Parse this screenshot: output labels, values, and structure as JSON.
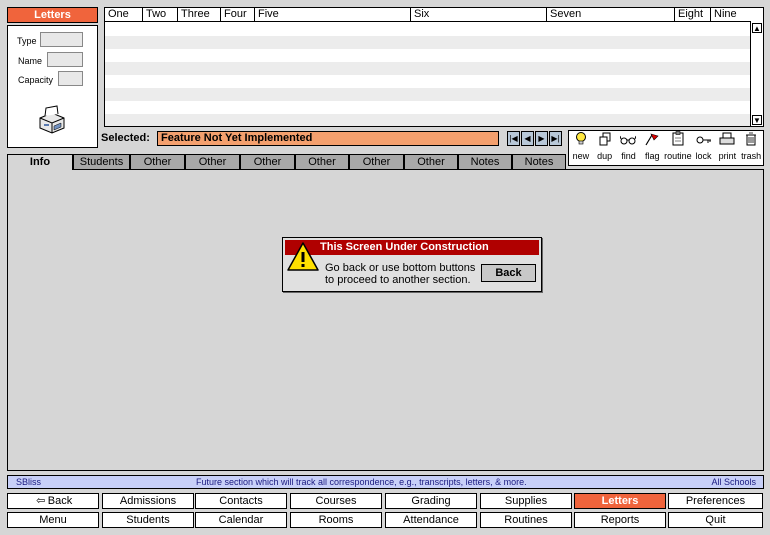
{
  "panel": {
    "title": "Letters",
    "fields": [
      {
        "label": "Type",
        "value": ""
      },
      {
        "label": "Name",
        "value": ""
      },
      {
        "label": "Capacity",
        "value": ""
      }
    ],
    "printer_icon": "printer-icon"
  },
  "grid": {
    "columns": [
      "One",
      "Two",
      "Three",
      "Four",
      "Five",
      "Six",
      "Seven",
      "Eight",
      "Nine"
    ],
    "rows": []
  },
  "selected": {
    "label": "Selected:",
    "value": "Feature Not Yet Implemented"
  },
  "record_nav": [
    "first",
    "prev",
    "next",
    "last"
  ],
  "toolbar": [
    {
      "label": "new",
      "icon": "lightbulb-icon"
    },
    {
      "label": "dup",
      "icon": "duplicate-icon"
    },
    {
      "label": "find",
      "icon": "glasses-icon"
    },
    {
      "label": "flag",
      "icon": "flag-icon"
    },
    {
      "label": "routine",
      "icon": "clipboard-icon"
    },
    {
      "label": "lock",
      "icon": "key-icon"
    },
    {
      "label": "print",
      "icon": "printer-icon"
    },
    {
      "label": "trash",
      "icon": "trash-icon"
    }
  ],
  "tabs": [
    "Info",
    "Students",
    "Other",
    "Other",
    "Other",
    "Other",
    "Other",
    "Other",
    "Notes",
    "Notes"
  ],
  "active_tab": "Info",
  "dialog": {
    "title": "This Screen Under Construction",
    "message_line1": "Go back or use bottom buttons",
    "message_line2": "to proceed to another section.",
    "button": "Back"
  },
  "status": {
    "user": "SBliss",
    "message": "Future section which will track all correspondence, e.g., transcripts, letters, & more.",
    "scope": "All Schools"
  },
  "nav_row1": [
    "Back",
    "Admissions",
    "Contacts",
    "Courses",
    "Grading",
    "Supplies",
    "Letters",
    "Preferences"
  ],
  "nav_row2": [
    "Menu",
    "Students",
    "Calendar",
    "Rooms",
    "Attendance",
    "Routines",
    "Reports",
    "Quit"
  ],
  "active_nav": "Letters",
  "colors": {
    "accent": "#f0643c",
    "selected_field": "#f4a06e",
    "dialog_title": "#b00000",
    "status_bar": "#c8d0f8"
  }
}
